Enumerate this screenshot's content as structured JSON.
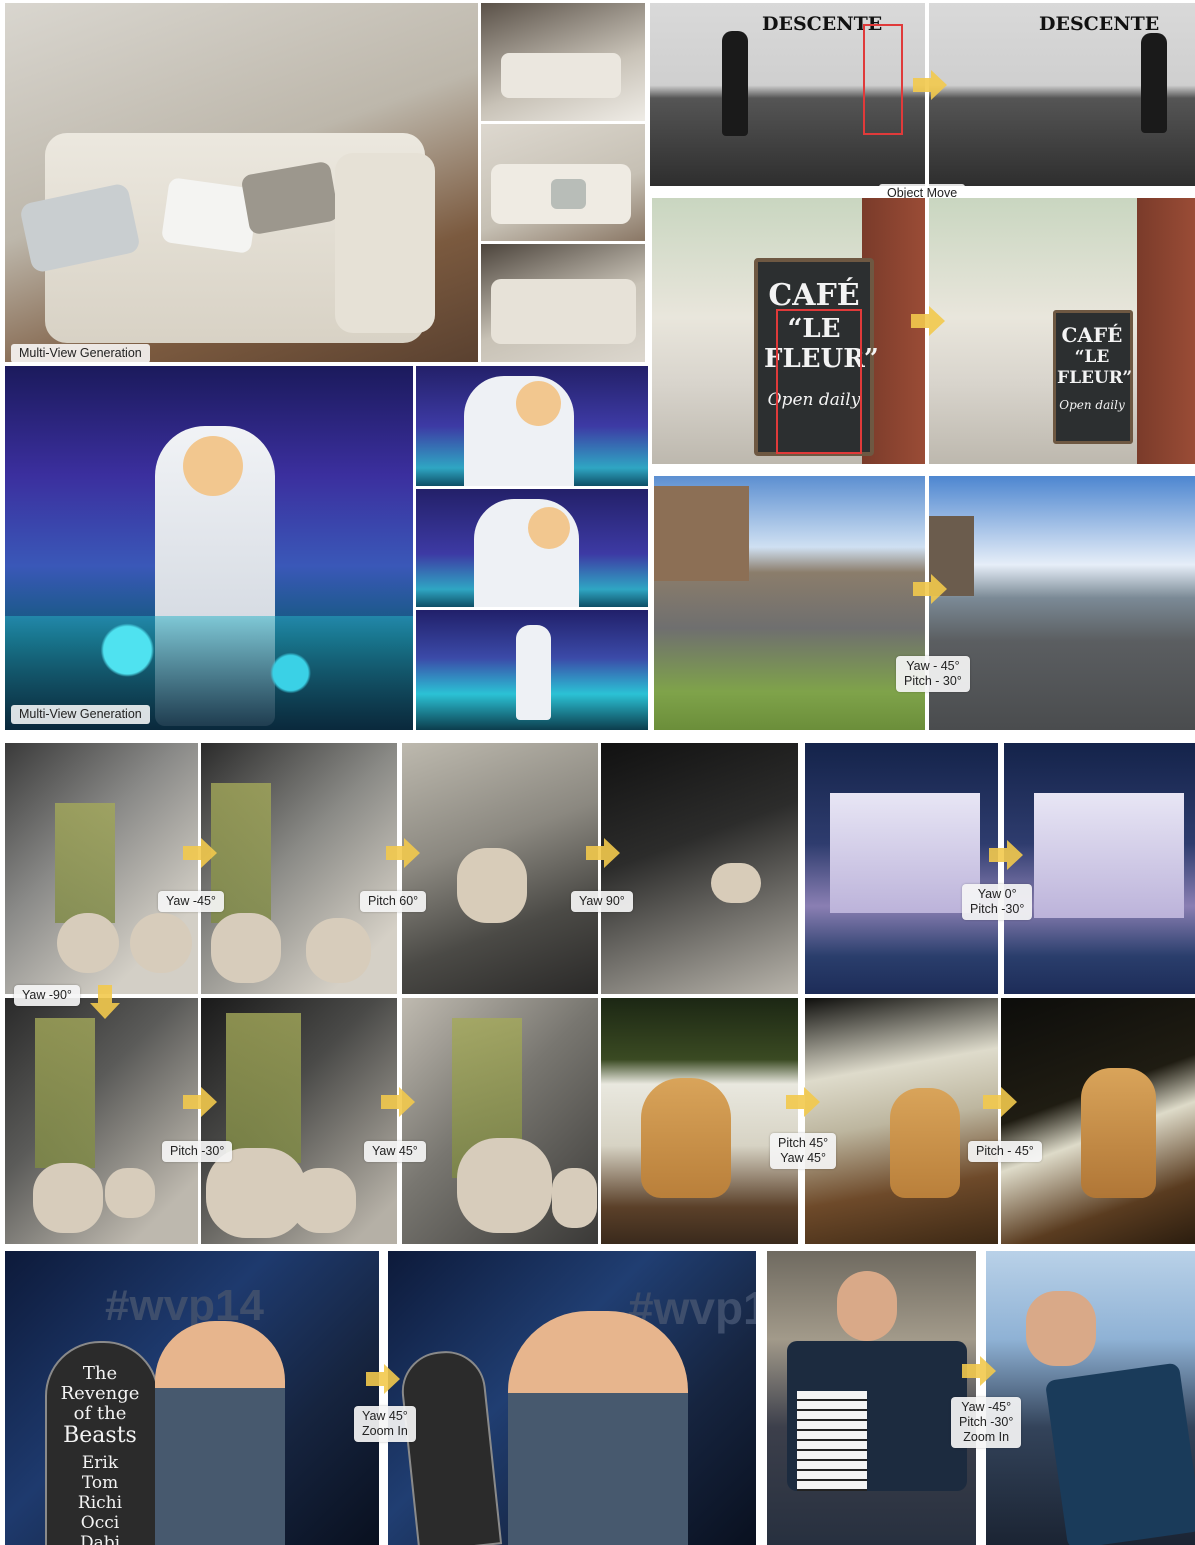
{
  "labels": {
    "multiview_1": "Multi-View Generation",
    "multiview_2": "Multi-View Generation",
    "object_move": "Object Move"
  },
  "signs": {
    "wall_text_left": "DESCENTE",
    "wall_text_right": "DESCENTE",
    "cafe_line1": "CAFÉ",
    "cafe_line2": "“LE",
    "cafe_line3": "FLEUR”",
    "cafe_line4": "Open daily",
    "board_title_1": "The",
    "board_title_2": "Revenge",
    "board_title_3": "of the",
    "board_title_4": "Beasts",
    "board_names": "Erik\nTom\nRichi\nOcci\nDabi\nCarsti",
    "banner": "#wvp14"
  },
  "tags": {
    "street": [
      "Yaw - 45°",
      "Pitch - 30°"
    ],
    "plant_1": [
      "Yaw  -45°"
    ],
    "plant_2": [
      "Pitch  60°"
    ],
    "plant_3": [
      "Yaw  90°"
    ],
    "house": [
      "Yaw 0°",
      "Pitch -30°"
    ],
    "plant_down": [
      "Yaw  -90°"
    ],
    "plant_4": [
      "Pitch  -30°"
    ],
    "plant_5": [
      "Yaw  45°"
    ],
    "dog_1": [
      "Pitch 45°",
      "Yaw 45°"
    ],
    "dog_2": [
      "Pitch - 45°"
    ],
    "party": [
      "Yaw 45°",
      "Zoom In"
    ],
    "accordion": [
      "Yaw -45°",
      "Pitch -30°",
      "Zoom In"
    ]
  },
  "colors": {
    "arrow": "#f2c94c",
    "redbox": "#e03a3a",
    "label_bg": "#f5f5f5"
  }
}
